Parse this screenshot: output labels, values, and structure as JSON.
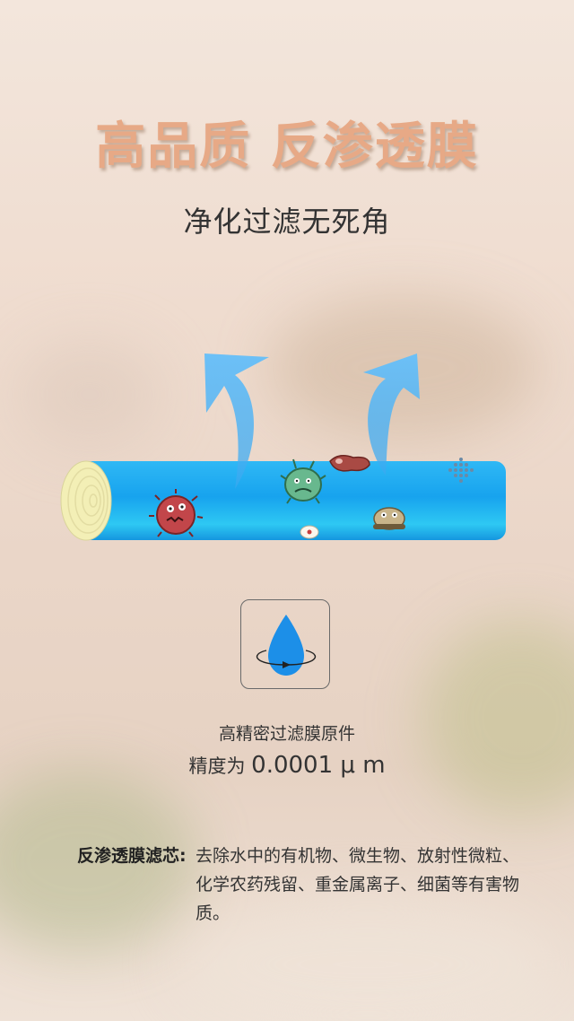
{
  "headline": "高品质 反渗透膜",
  "subtitle": "净化过滤无死角",
  "icon": "water-drop-rotation-icon",
  "feature": {
    "line1": "高精密过滤膜原件",
    "precision_prefix": "精度为 ",
    "precision_value": "0.0001 μ m"
  },
  "description": {
    "label": "反渗透膜滤芯:",
    "text": "去除水中的有机物、微生物、放射性微粒、化学农药残留、重金属离子、细菌等有害物质。"
  },
  "colors": {
    "headline": "#e7a986",
    "tube": "#1aa8ef",
    "arrow": "#5ab8f5",
    "drop": "#1c8fe8"
  }
}
